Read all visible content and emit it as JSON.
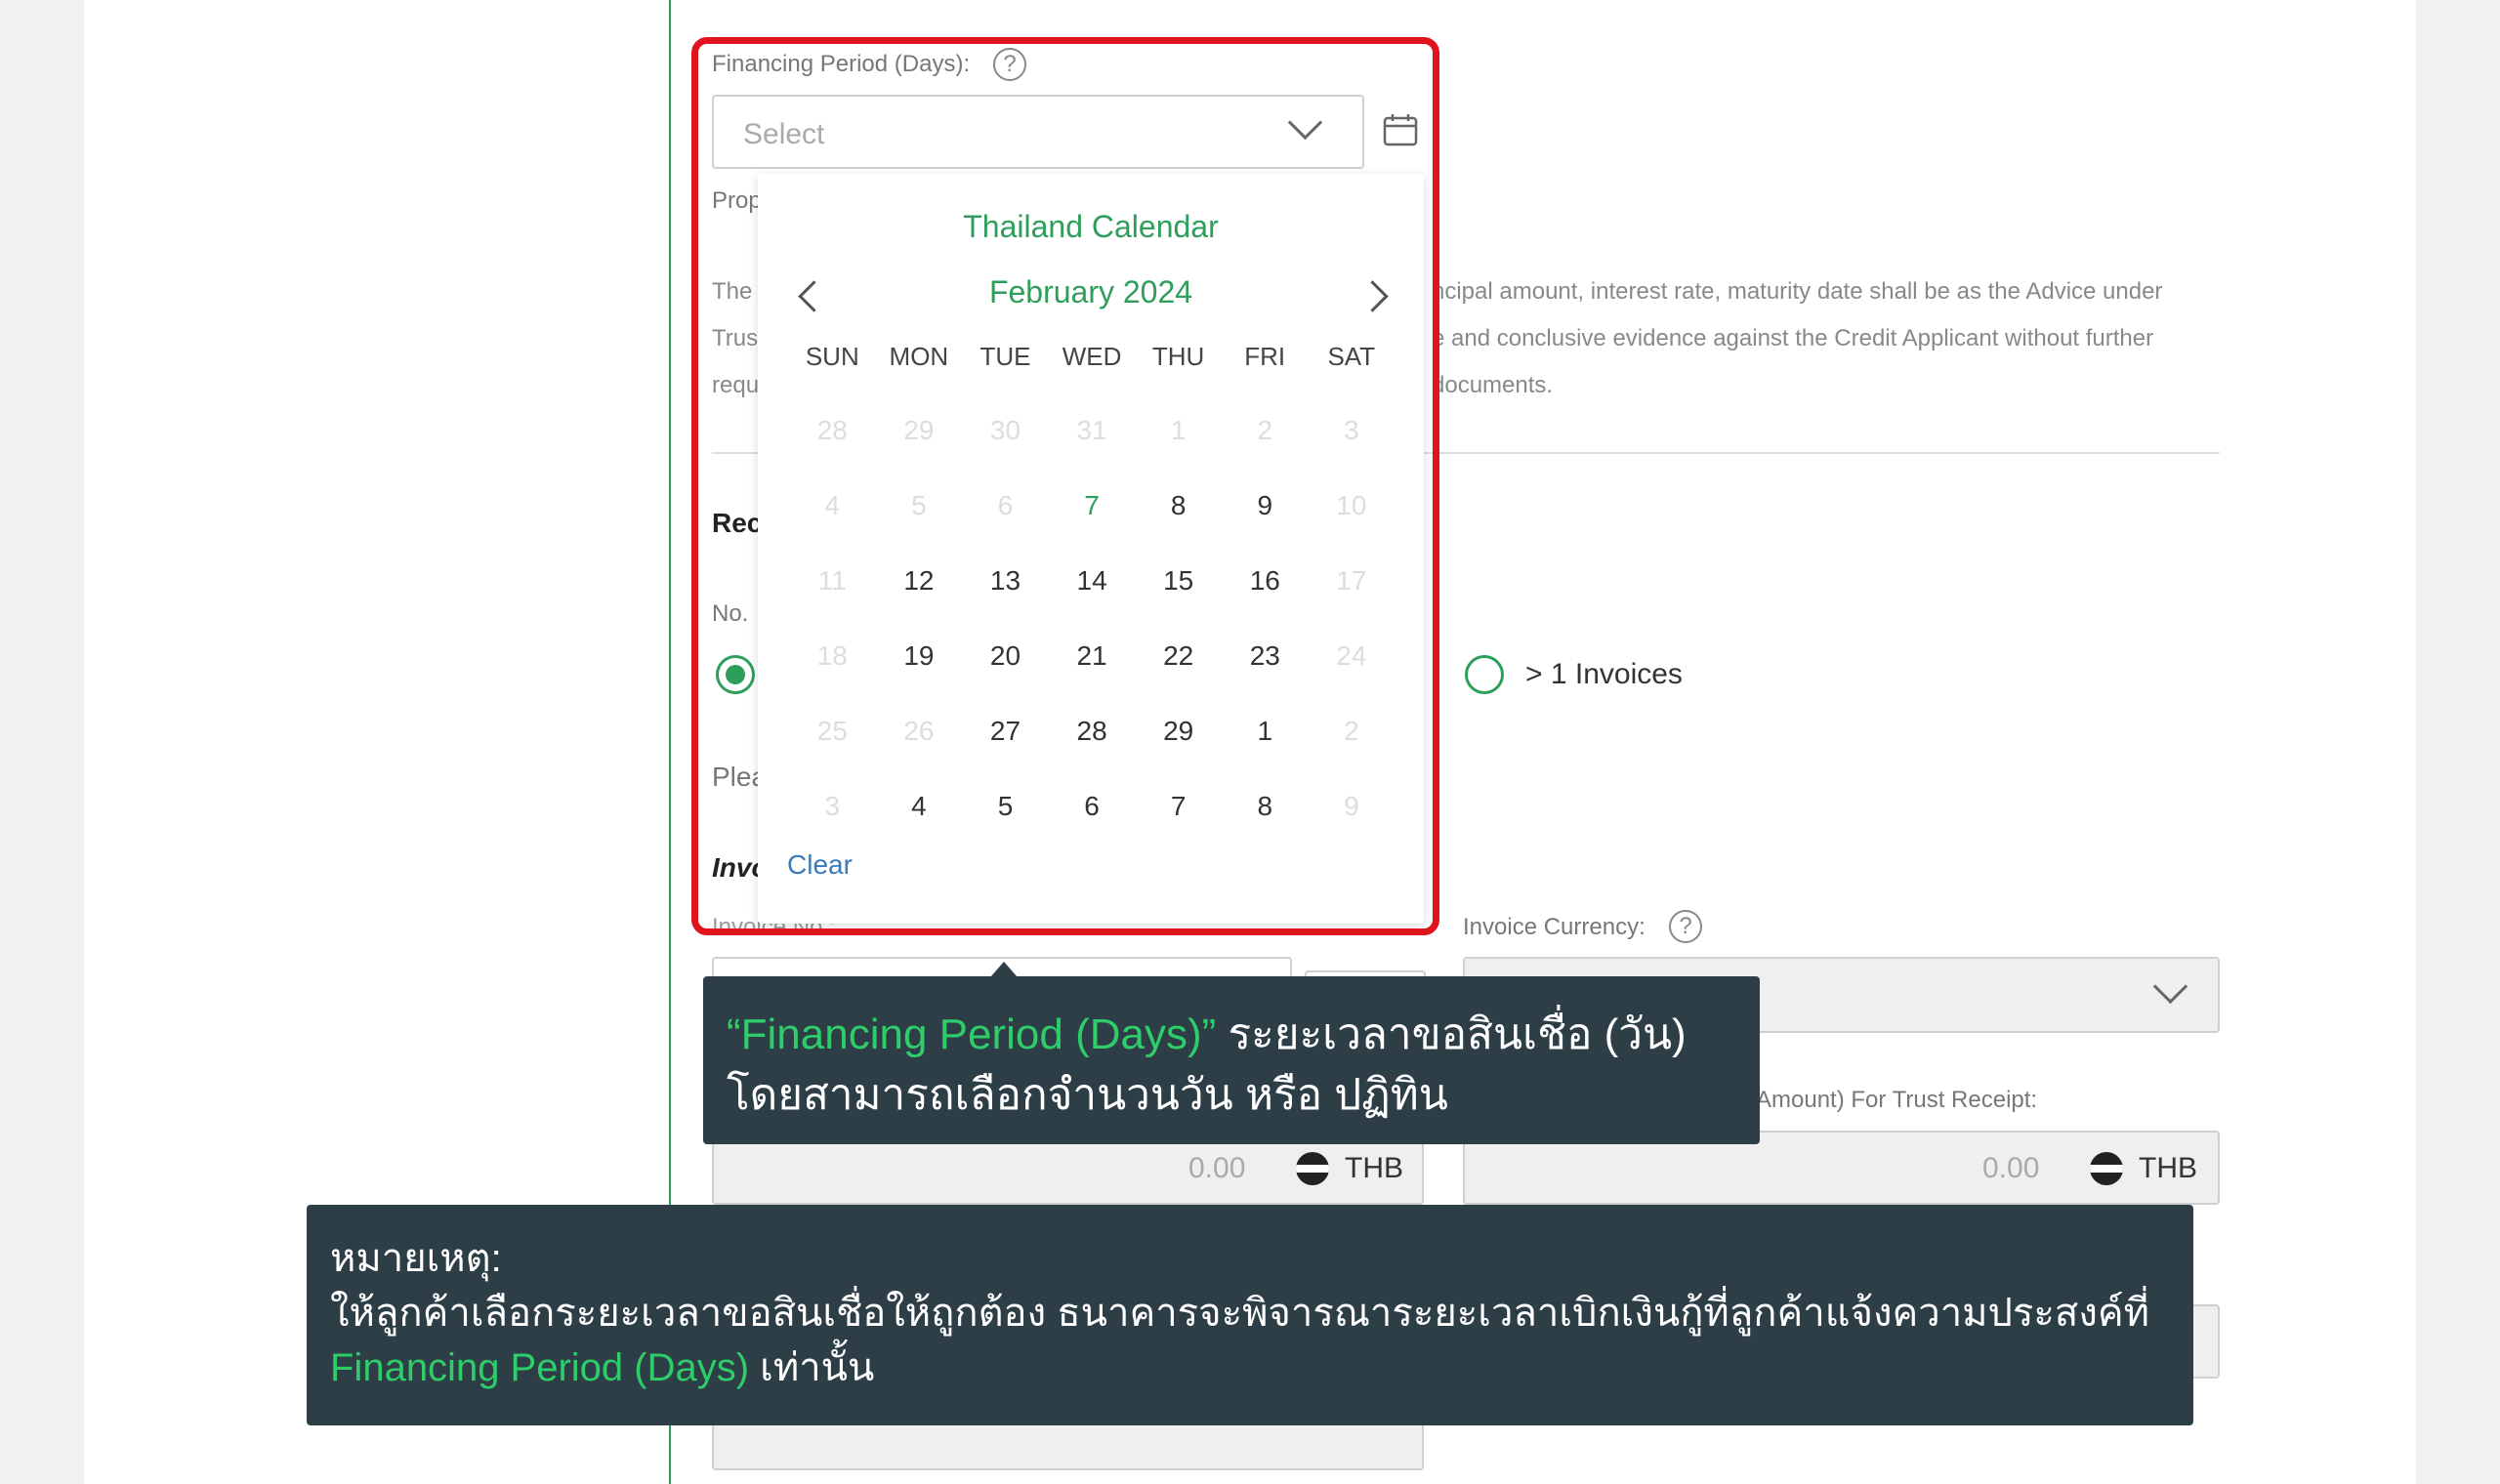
{
  "financing_period": {
    "label": "Financing Period (Days):",
    "help": "?",
    "placeholder": "Select"
  },
  "partial_texts": {
    "prop_label": "Prop",
    "desc_left": [
      "The",
      "Trus",
      "requ"
    ],
    "desc_right": [
      "ncipal amount, interest rate, maturity date shall be as the Advice under",
      "e and conclusive evidence against the Credit Applicant without further",
      "documents."
    ],
    "rec_heading": "Rec",
    "no_label": "No. ",
    "please": "Plea",
    "invoice_heading": "Invo",
    "invoice_no_label": "Invoice No :",
    "amount_label_partial": "Amount) For Trust Receipt:"
  },
  "radio_options": {
    "more_invoices": "> 1 Invoices"
  },
  "invoice_currency": {
    "label": "Invoice Currency:",
    "help": "?"
  },
  "amounts": [
    {
      "value": "0.00",
      "currency": "THB"
    },
    {
      "value": "0.00",
      "currency": "THB"
    }
  ],
  "calendar": {
    "title": "Thailand Calendar",
    "month": "February 2024",
    "weekdays": [
      "SUN",
      "MON",
      "TUE",
      "WED",
      "THU",
      "FRI",
      "SAT"
    ],
    "days": [
      [
        "28",
        "29",
        "30",
        "31",
        "1",
        "2",
        "3"
      ],
      [
        "4",
        "5",
        "6",
        "7",
        "8",
        "9",
        "10"
      ],
      [
        "11",
        "12",
        "13",
        "14",
        "15",
        "16",
        "17"
      ],
      [
        "18",
        "19",
        "20",
        "21",
        "22",
        "23",
        "24"
      ],
      [
        "25",
        "26",
        "27",
        "28",
        "29",
        "1",
        "2"
      ],
      [
        "3",
        "4",
        "5",
        "6",
        "7",
        "8",
        "9"
      ]
    ],
    "clear_label": "Clear"
  },
  "callout_top": {
    "highlight": "“Financing Period (Days)”",
    "line1_rest": " ระยะเวลาขอสินเชื่อ (วัน)",
    "line2": "โดยสามารถเลือกจำนวนวัน หรือ ปฏิทิน"
  },
  "callout_note": {
    "heading": "หมายเหตุ:",
    "line1": "ให้ลูกค้าเลือกระยะเวลาขอสินเชื่อให้ถูกต้อง ธนาคารจะพิจารณาระยะเวลาเบิกเงินกู้ที่ลูกค้าแจ้งความประสงค์ที่",
    "highlight": "Financing Period (Days)",
    "line2_rest": " เท่านั้น"
  },
  "colors": {
    "accent_green": "#2e9e5b",
    "highlight_red": "#e0141e",
    "callout_bg": "#2d3e47",
    "callout_highlight": "#2fcc6a"
  }
}
